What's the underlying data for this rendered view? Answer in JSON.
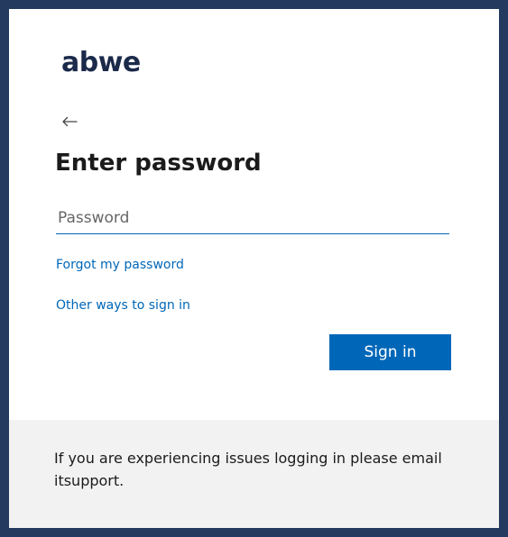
{
  "brand": {
    "logo_text": "abwe",
    "logo_color": "#1b2a4a"
  },
  "nav": {
    "back_icon": "arrow-left-icon"
  },
  "form": {
    "title": "Enter password",
    "password_placeholder": "Password",
    "password_value": "",
    "forgot_link": "Forgot my password",
    "other_ways_link": "Other ways to sign in",
    "signin_label": "Sign in"
  },
  "footer": {
    "message": "If you are experiencing issues logging in please email itsupport."
  },
  "colors": {
    "frame_border": "#243a5e",
    "accent": "#0067b8",
    "footer_bg": "#f2f2f2"
  }
}
